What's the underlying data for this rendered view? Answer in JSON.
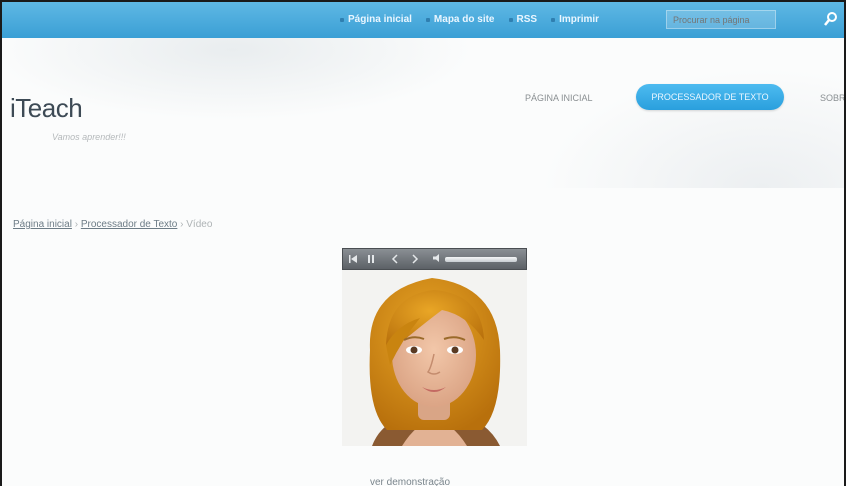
{
  "topbar": {
    "links": [
      "Página inicial",
      "Mapa do site",
      "RSS",
      "Imprimir"
    ],
    "search_placeholder": "Procurar na página"
  },
  "header": {
    "logo": "iTeach",
    "tagline": "Vamos aprender!!!",
    "nav": {
      "home": "PÁGINA INICIAL",
      "active": "PROCESSADOR DE TEXTO",
      "about": "SOBRE"
    }
  },
  "breadcrumb": {
    "home": "Página inicial",
    "separator": " › ",
    "section": "Processador de Texto",
    "current": "Vídeo"
  },
  "video": {
    "caption_link": "ver demonstração"
  },
  "colors": {
    "topbar": "#3a9fd5",
    "nav_active": "#2a9fdd",
    "player_bar": "#6a6f74"
  }
}
